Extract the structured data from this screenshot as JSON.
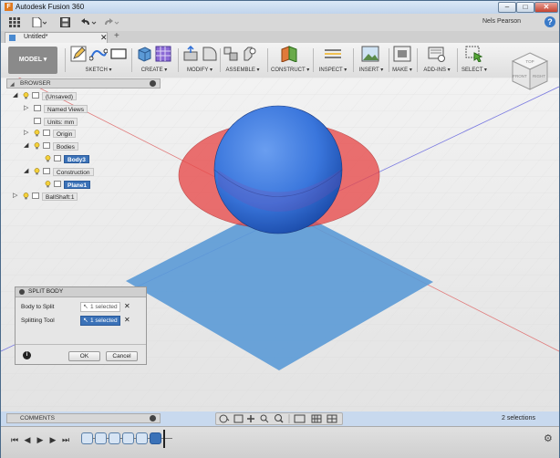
{
  "window": {
    "title": "Autodesk Fusion 360",
    "app_logo": "F",
    "minimize_glyph": "–",
    "maximize_glyph": "□",
    "close_glyph": "✕"
  },
  "quick_access": {
    "user_name": "Nels Pearson",
    "help_glyph": "?"
  },
  "document_tab": {
    "label": "Untitled*",
    "close_glyph": "✕",
    "new_tab_glyph": "+"
  },
  "toolbar": {
    "workspace": "MODEL ▾",
    "groups": [
      {
        "label": "SKETCH ▾",
        "icons": [
          "pencil-icon",
          "arc-icon",
          "rectangle-icon"
        ]
      },
      {
        "label": "CREATE ▾",
        "icons": [
          "box-icon",
          "pattern-icon"
        ]
      },
      {
        "label": "MODIFY ▾",
        "icons": [
          "press-pull-icon",
          "fillet-icon"
        ]
      },
      {
        "label": "ASSEMBLE ▾",
        "icons": [
          "new-component-icon",
          "joint-icon"
        ]
      },
      {
        "label": "CONSTRUCT ▾",
        "icons": [
          "plane-icon"
        ]
      },
      {
        "label": "INSPECT ▾",
        "icons": [
          "measure-icon"
        ]
      },
      {
        "label": "INSERT ▾",
        "icons": [
          "insert-image-icon"
        ]
      },
      {
        "label": "MAKE ▾",
        "icons": [
          "print-3d-icon"
        ]
      },
      {
        "label": "ADD-INS ▾",
        "icons": [
          "scripts-icon"
        ]
      },
      {
        "label": "SELECT ▾",
        "icons": [
          "select-icon"
        ]
      }
    ]
  },
  "viewcube": {
    "top": "TOP",
    "front": "FRONT",
    "right": "RIGHT"
  },
  "browser": {
    "title": "BROWSER",
    "items": [
      {
        "label": "(Unsaved)",
        "indent": 0,
        "toggle": "◢",
        "selected": false,
        "bulb": true
      },
      {
        "label": "Named Views",
        "indent": 1,
        "toggle": "▷",
        "selected": false,
        "bulb": false
      },
      {
        "label": "Units: mm",
        "indent": 1,
        "toggle": "",
        "selected": false,
        "bulb": false
      },
      {
        "label": "Origin",
        "indent": 1,
        "toggle": "▷",
        "selected": false,
        "bulb": true
      },
      {
        "label": "Bodies",
        "indent": 1,
        "toggle": "◢",
        "selected": false,
        "bulb": true
      },
      {
        "label": "Body3",
        "indent": 2,
        "toggle": "",
        "selected": true,
        "bulb": true
      },
      {
        "label": "Construction",
        "indent": 1,
        "toggle": "◢",
        "selected": false,
        "bulb": true
      },
      {
        "label": "Plane1",
        "indent": 2,
        "toggle": "",
        "selected": true,
        "bulb": true
      },
      {
        "label": "BallShaft:1",
        "indent": 0,
        "toggle": "▷",
        "selected": false,
        "bulb": true
      }
    ]
  },
  "split_body": {
    "title": "SPLIT BODY",
    "body_to_split_label": "Body to Split",
    "body_to_split_value": "1 selected",
    "splitting_tool_label": "Splitting Tool",
    "splitting_tool_value": "1 selected",
    "clear_glyph": "✕",
    "info_glyph": "i",
    "ok": "OK",
    "cancel": "Cancel"
  },
  "comments": {
    "label": "COMMENTS"
  },
  "status": {
    "selection_count": "2 selections"
  },
  "timeline": {
    "controls": [
      "⏮",
      "◀",
      "▶",
      "▶",
      "⏭"
    ],
    "settings_glyph": "⚙"
  },
  "colors": {
    "sphere": "#2f6fd6",
    "split_plane": "#e84a4a",
    "ground_plane": "#5b9ad6",
    "selection": "#3b72b8"
  }
}
